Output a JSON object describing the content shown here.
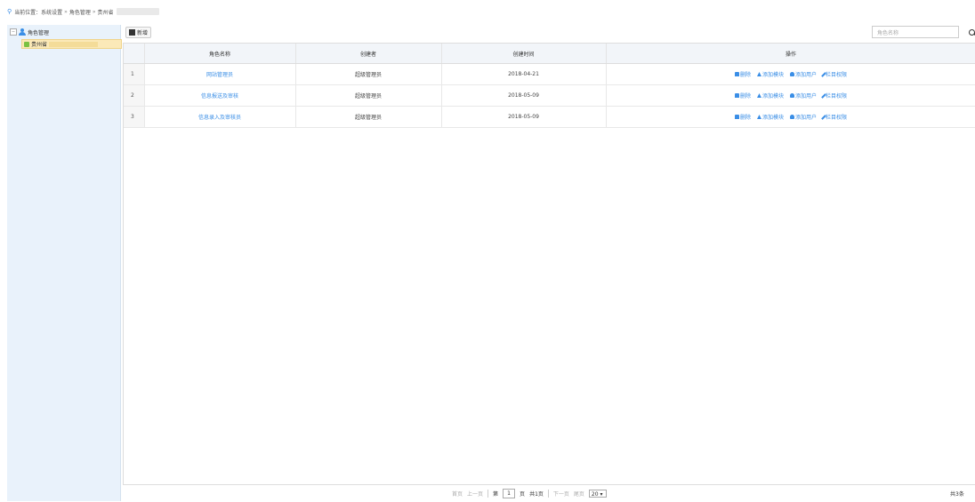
{
  "breadcrumb": {
    "prefix": "当前位置：",
    "items": [
      "系统设置",
      "角色管理",
      "贵州省"
    ],
    "separator": "»"
  },
  "sidebar": {
    "root_label": "角色管理",
    "child_label": "贵州省"
  },
  "toolbar": {
    "new_label": "新增",
    "search_placeholder": "角色名称"
  },
  "table": {
    "columns": [
      "角色名称",
      "创建者",
      "创建时间",
      "操作"
    ],
    "rows": [
      {
        "num": "1",
        "name": "网站管理员",
        "creator": "超级管理员",
        "created": "2018-04-21"
      },
      {
        "num": "2",
        "name": "信息报送及审核",
        "creator": "超级管理员",
        "created": "2018-05-09"
      },
      {
        "num": "3",
        "name": "信息录入及审核员",
        "creator": "超级管理员",
        "created": "2018-05-09"
      }
    ],
    "actions": {
      "delete": "删除",
      "add_module": "添加模块",
      "add_user": "添加用户",
      "column_perm": "栏目权限"
    }
  },
  "pager": {
    "first": "首页",
    "prev": "上一页",
    "page_prefix": "第",
    "page_value": "1",
    "page_suffix": "页",
    "total_pages": "共1页",
    "next": "下一页",
    "last": "尾页",
    "page_size": "20",
    "total_records": "共3条"
  },
  "colors": {
    "accent": "#3a8ee6",
    "sidebar_bg": "#e9f2fb",
    "selected_bg": "#fbe9b8"
  }
}
